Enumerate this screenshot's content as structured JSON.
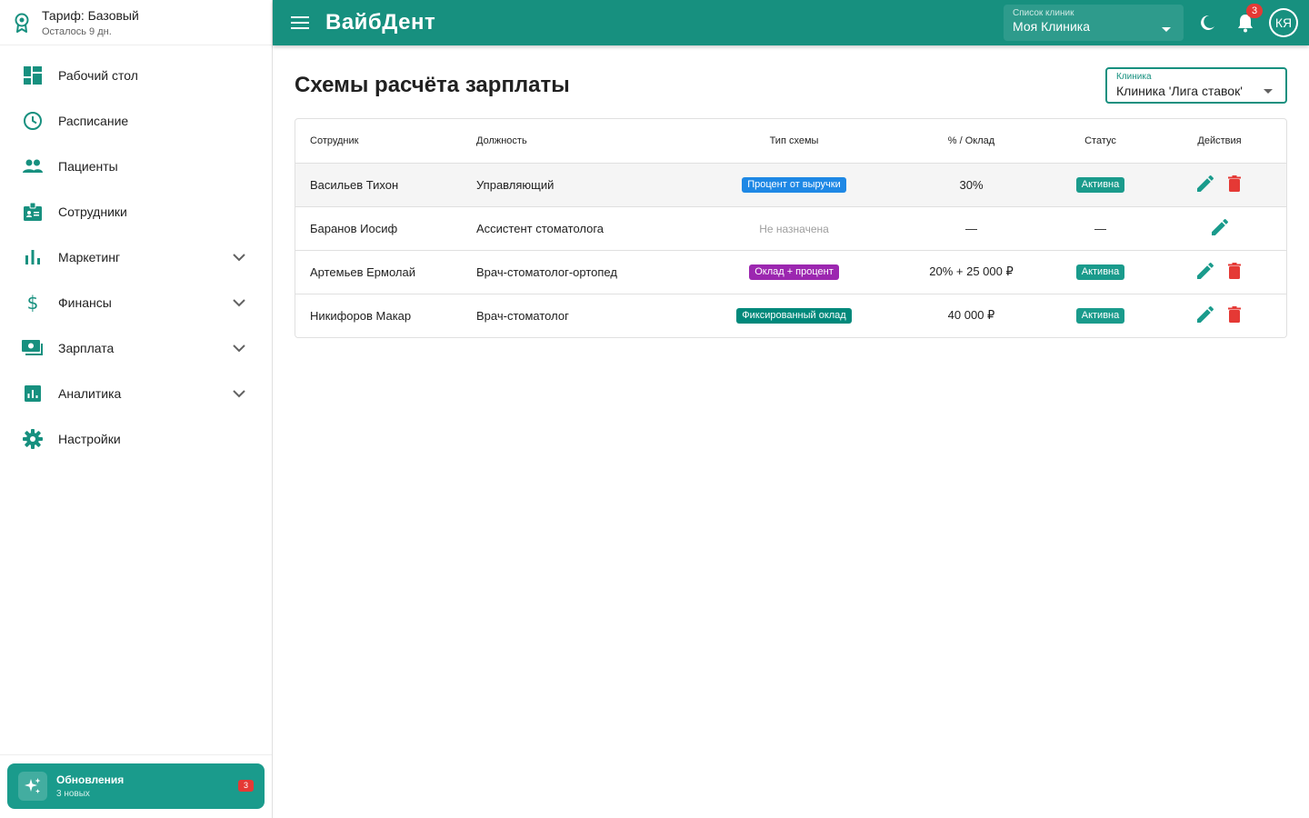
{
  "sidebar": {
    "plan": {
      "title": "Тариф: Базовый",
      "subtitle": "Осталось 9 дн."
    },
    "items": [
      {
        "label": "Рабочий стол",
        "icon": "dashboard-icon"
      },
      {
        "label": "Расписание",
        "icon": "clock-icon"
      },
      {
        "label": "Пациенты",
        "icon": "people-icon"
      },
      {
        "label": "Сотрудники",
        "icon": "badge-icon"
      },
      {
        "label": "Маркетинг",
        "icon": "bar-chart-icon",
        "expandable": true
      },
      {
        "label": "Финансы",
        "icon": "dollar-icon",
        "expandable": true
      },
      {
        "label": "Зарплата",
        "icon": "payments-icon",
        "expandable": true
      },
      {
        "label": "Аналитика",
        "icon": "analytics-icon",
        "expandable": true
      },
      {
        "label": "Настройки",
        "icon": "gear-icon"
      }
    ],
    "updates": {
      "title": "Обновления",
      "subtitle": "3 новых",
      "badge": "3"
    }
  },
  "header": {
    "brand": "ВайбДент",
    "clinic_select": {
      "label": "Список клиник",
      "value": "Моя Клиника"
    },
    "notifications_count": "3",
    "avatar_initials": "КЯ"
  },
  "main": {
    "title": "Схемы расчёта зарплаты",
    "filter": {
      "label": "Клиника",
      "value": "Клиника 'Лига ставок'"
    },
    "table": {
      "columns": [
        "Сотрудник",
        "Должность",
        "Тип схемы",
        "% / Оклад",
        "Статус",
        "Действия"
      ],
      "rows": [
        {
          "employee": "Васильев Тихон",
          "position": "Управляющий",
          "scheme": "Процент от выручки",
          "scheme_color": "#1e88e5",
          "rate": "30%",
          "status": "Активна",
          "can_delete": true
        },
        {
          "employee": "Баранов Иосиф",
          "position": "Ассистент стоматолога",
          "scheme": "Не назначена",
          "scheme_color": "",
          "rate": "—",
          "status": "—",
          "can_delete": false
        },
        {
          "employee": "Артемьев Ермолай",
          "position": "Врач-стоматолог-ортопед",
          "scheme": "Оклад + процент",
          "scheme_color": "#9c27b0",
          "rate": "20% + 25 000 ₽",
          "status": "Активна",
          "can_delete": true
        },
        {
          "employee": "Никифоров Макар",
          "position": "Врач-стоматолог",
          "scheme": "Фиксированный оклад",
          "scheme_color": "#00897b",
          "rate": "40 000 ₽",
          "status": "Активна",
          "can_delete": true
        }
      ]
    }
  },
  "colors": {
    "primary": "#17907f",
    "status_active": "#1a9b8c",
    "delete": "#e53935",
    "edit": "#1a9b8c"
  }
}
